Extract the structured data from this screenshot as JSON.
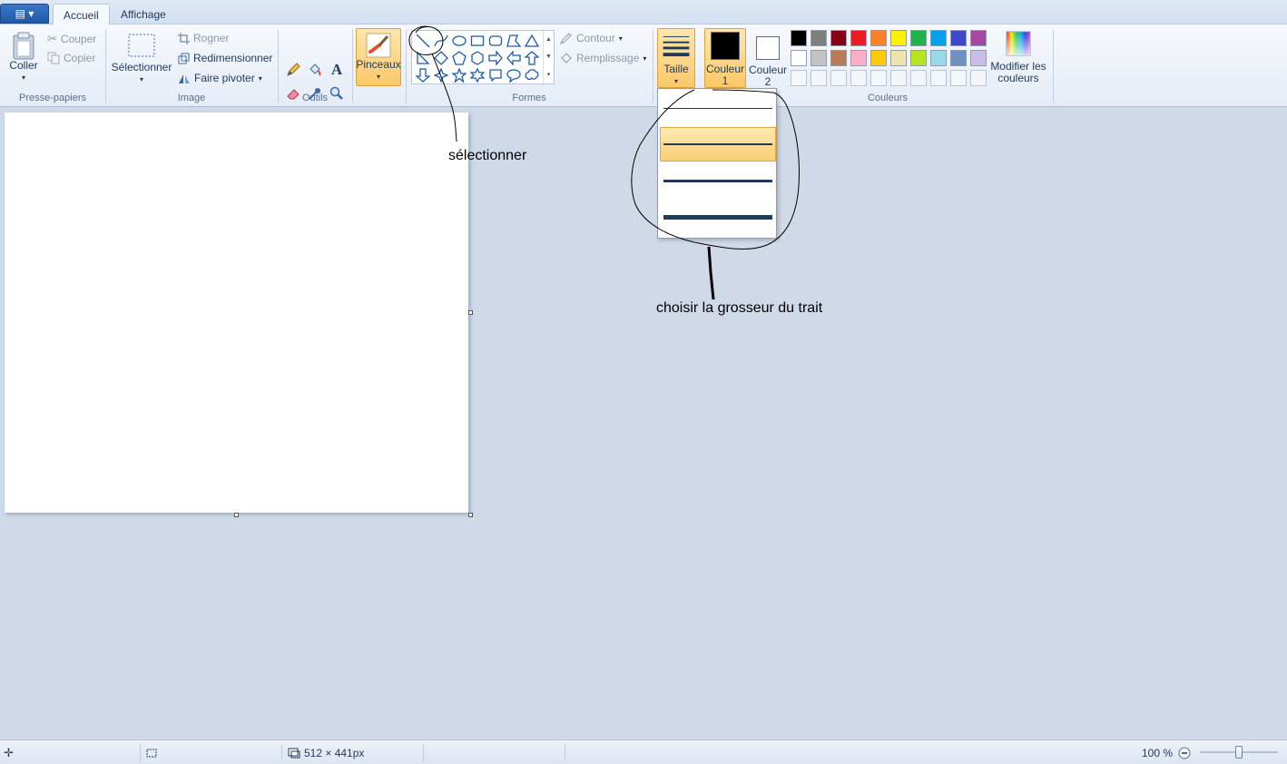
{
  "tabs": {
    "app_menu": "▤ ▾",
    "home": "Accueil",
    "view": "Affichage"
  },
  "clipboard": {
    "paste": "Coller",
    "cut": "Couper",
    "copy": "Copier",
    "label": "Presse-papiers"
  },
  "image": {
    "select": "Sélectionner",
    "crop": "Rogner",
    "resize": "Redimensionner",
    "rotate": "Faire pivoter",
    "label": "Image"
  },
  "tools": {
    "label": "Outils"
  },
  "brushes": {
    "label": "Pinceaux"
  },
  "shapes": {
    "outline": "Contour",
    "fill": "Remplissage",
    "label": "Formes"
  },
  "size": {
    "label": "Taille"
  },
  "color1": {
    "label_line1": "Couleur",
    "label_line2": "1",
    "value": "#000000"
  },
  "color2": {
    "label_line1": "Couleur",
    "label_line2": "2",
    "value": "#ffffff"
  },
  "colors": {
    "label": "Couleurs",
    "edit_line1": "Modifier les",
    "edit_line2": "couleurs",
    "row1": [
      "#000000",
      "#7f7f7f",
      "#880015",
      "#ed1c24",
      "#ff7f27",
      "#fff200",
      "#22b14c",
      "#00a2e8",
      "#3f48cc",
      "#a349a4"
    ],
    "row2": [
      "#ffffff",
      "#c3c3c3",
      "#b97a57",
      "#ffaec9",
      "#ffc90e",
      "#efe4b0",
      "#b5e61d",
      "#99d9ea",
      "#7092be",
      "#c8bfe7"
    ]
  },
  "annotations": {
    "select": "sélectionner",
    "thickness": "choisir la grosseur du trait"
  },
  "status": {
    "dimensions": "512 × 441px",
    "zoom": "100 %"
  }
}
